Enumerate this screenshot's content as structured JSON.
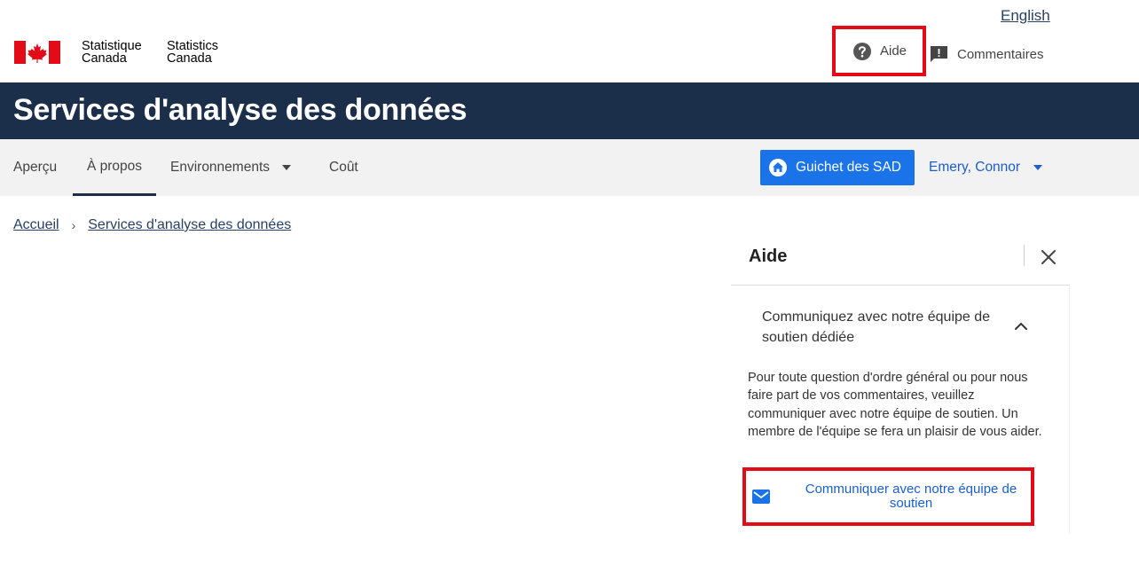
{
  "header": {
    "language_toggle": "English",
    "signature": {
      "fr_line1": "Statistique",
      "fr_line2": "Canada",
      "en_line1": "Statistics",
      "en_line2": "Canada"
    },
    "help_label": "Aide",
    "feedback_label": "Commentaires",
    "icons": {
      "help": "question-circle-icon",
      "feedback": "comment-alert-icon",
      "flag": "canada-flag"
    }
  },
  "title_band": {
    "title": "Services d'analyse des données",
    "bg_color": "#1c2f4a"
  },
  "nav": {
    "items": [
      {
        "label": "Aperçu",
        "active": false
      },
      {
        "label": "À propos",
        "active": true
      },
      {
        "label": "Environnements",
        "active": false,
        "dropdown": true
      },
      {
        "label": "Coût",
        "active": false
      }
    ],
    "portal_button": "Guichet des SAD",
    "user_menu": "Emery, Connor",
    "accent_color": "#1a73e8"
  },
  "breadcrumb": [
    "Accueil",
    "Services d'analyse des données"
  ],
  "help_panel": {
    "title": "Aide",
    "accordion_title": "Communiquez avec notre équipe de soutien dédiée",
    "accordion_expanded": true,
    "body": "Pour toute question d'ordre général ou pour nous faire part de vos commentaires, veuillez communiquer avec notre équipe de soutien. Un membre de l'équipe se fera un plaisir de vous aider.",
    "contact_link": "Communiquer avec notre équipe de soutien"
  },
  "highlight_color": "#e30b17"
}
